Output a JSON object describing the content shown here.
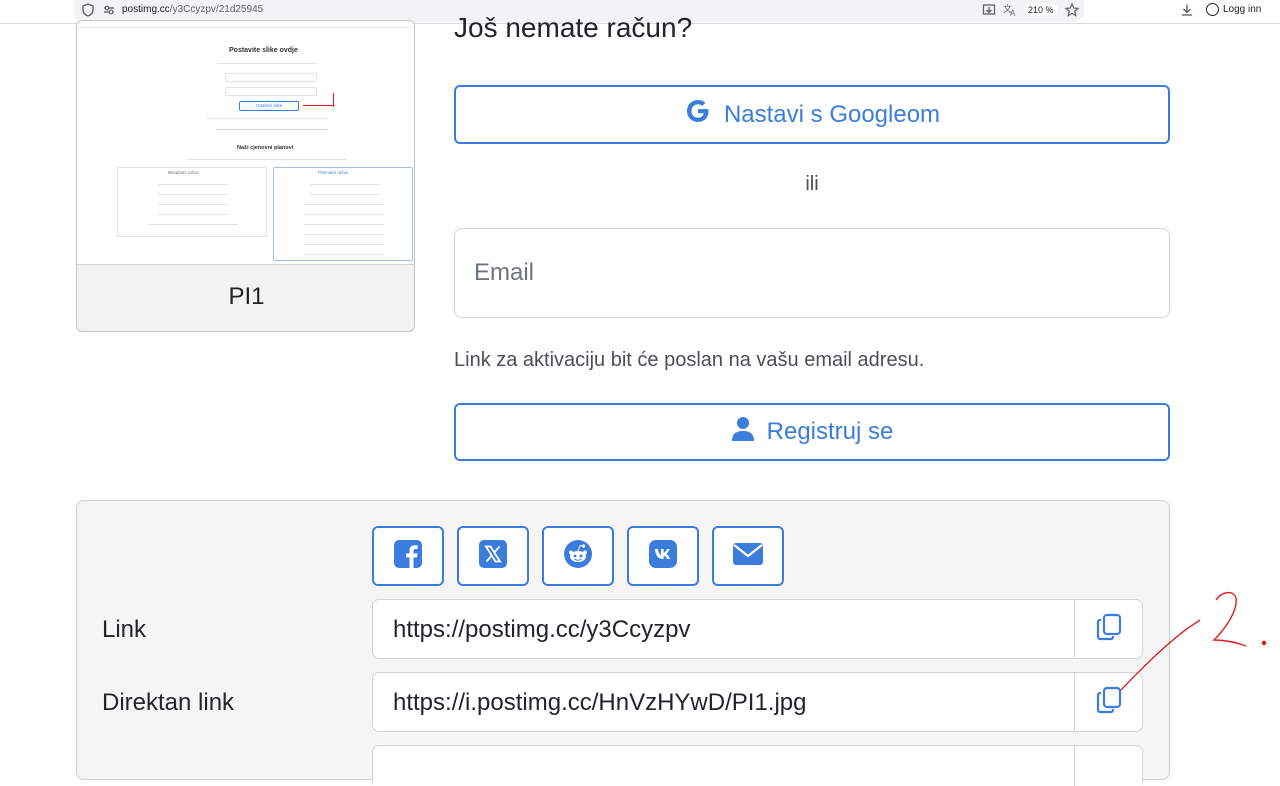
{
  "browser": {
    "url_host": "postimg.cc",
    "url_path": "/y3Ccyzpv/21d25945",
    "zoom": "210 %",
    "login_label": "Logg inn"
  },
  "thumbnail": {
    "caption": "PI1",
    "mini_page": {
      "title": "Postavite slike ovdje",
      "subtitle": "Naši cjenovni planovi",
      "upload_button": "Odaberi slike",
      "free_plan": "Besplatni račun",
      "premium_plan": "Premium račun"
    }
  },
  "signup": {
    "heading": "Još nemate račun?",
    "google_label": "Nastavi s Googleom",
    "or_label": "ili",
    "email_placeholder": "Email",
    "info": "Link za aktivaciju bit će poslan na vašu email adresu.",
    "register_label": "Registruj se"
  },
  "share": {
    "buttons": [
      "facebook",
      "x-twitter",
      "reddit",
      "vk",
      "email"
    ],
    "rows": [
      {
        "label": "Link",
        "value": "https://postimg.cc/y3Ccyzpv"
      },
      {
        "label": "Direktan link",
        "value": "https://i.postimg.cc/HnVzHYwD/PI1.jpg"
      }
    ]
  },
  "annotation": {
    "text": "2.",
    "color": "#e02020"
  },
  "colors": {
    "accent": "#3b7ddd",
    "panel_bg": "#f5f5f5",
    "border": "#ced4da"
  }
}
